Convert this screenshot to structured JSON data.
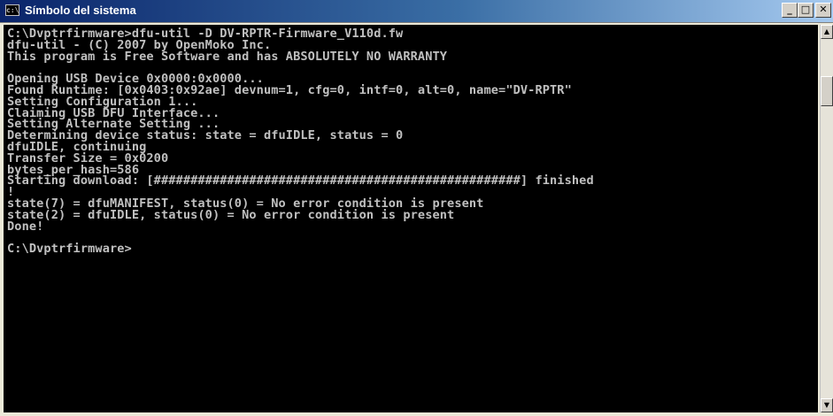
{
  "window": {
    "title": "Símbolo del sistema",
    "icon": "console-icon",
    "buttons": {
      "minimize": "_",
      "maximize": "□",
      "close": "✕"
    }
  },
  "console": {
    "lines": [
      "C:\\Dvptrfirmware>dfu-util -D DV-RPTR-Firmware_V110d.fw",
      "dfu-util - (C) 2007 by OpenMoko Inc.",
      "This program is Free Software and has ABSOLUTELY NO WARRANTY",
      "",
      "Opening USB Device 0x0000:0x0000...",
      "Found Runtime: [0x0403:0x92ae] devnum=1, cfg=0, intf=0, alt=0, name=\"DV-RPTR\"",
      "Setting Configuration 1...",
      "Claiming USB DFU Interface...",
      "Setting Alternate Setting ...",
      "Determining device status: state = dfuIDLE, status = 0",
      "dfuIDLE, continuing",
      "Transfer Size = 0x0200",
      "bytes_per_hash=586",
      "Starting download: [##################################################] finished",
      "!",
      "state(7) = dfuMANIFEST, status(0) = No error condition is present",
      "state(2) = dfuIDLE, status(0) = No error condition is present",
      "Done!",
      "",
      "C:\\Dvptrfirmware>"
    ],
    "text_color": "#c0c0c0",
    "background": "#000000"
  },
  "scrollbar": {
    "up_arrow": "▲",
    "down_arrow": "▼"
  }
}
